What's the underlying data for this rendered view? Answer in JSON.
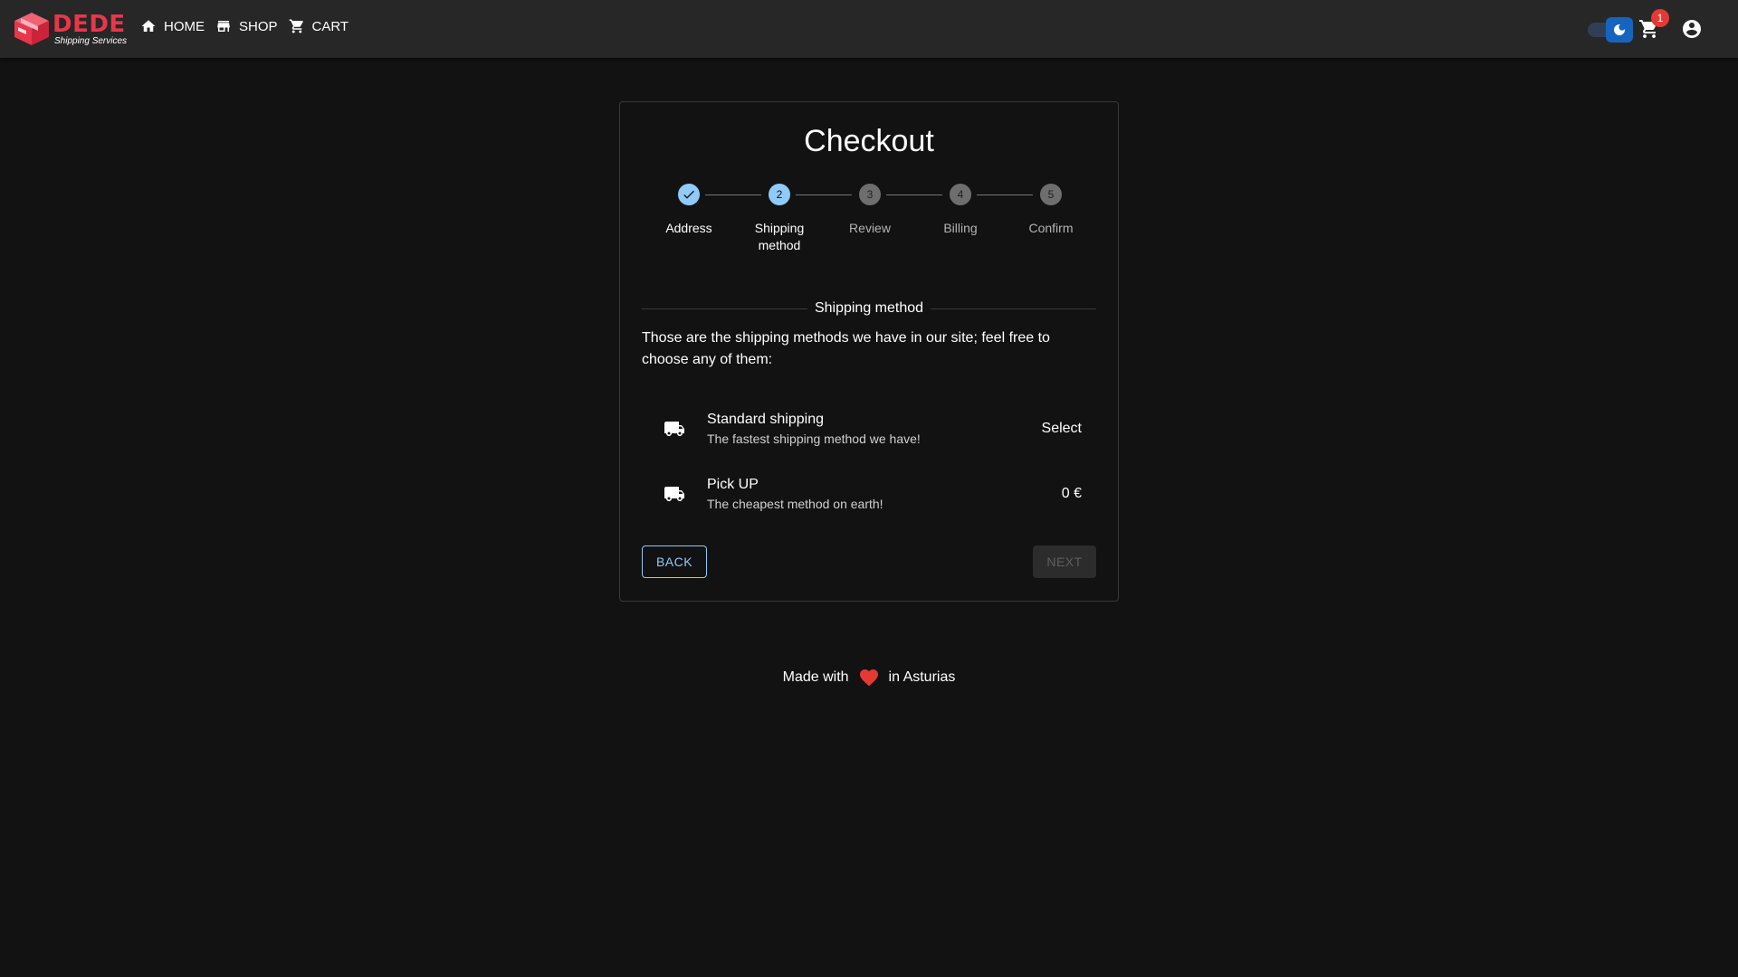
{
  "brand": {
    "name": "DEDE",
    "subtitle": "Shipping Services",
    "color": "#e8364a"
  },
  "nav": {
    "items": [
      {
        "label": "HOME",
        "icon": "home-icon"
      },
      {
        "label": "SHOP",
        "icon": "store-icon"
      },
      {
        "label": "CART",
        "icon": "cart-icon"
      }
    ]
  },
  "toolbar": {
    "theme_toggle_icon": "moon-icon",
    "cart_badge": "1",
    "account_icon": "account-circle-icon"
  },
  "checkout": {
    "title": "Checkout",
    "steps": [
      {
        "number": "1",
        "label": "Address",
        "state": "done"
      },
      {
        "number": "2",
        "label": "Shipping method",
        "state": "active"
      },
      {
        "number": "3",
        "label": "Review",
        "state": "pending"
      },
      {
        "number": "4",
        "label": "Billing",
        "state": "pending"
      },
      {
        "number": "5",
        "label": "Confirm",
        "state": "pending"
      }
    ],
    "section_title": "Shipping method",
    "intro": "Those are the shipping methods we have in our site; feel free to choose any of them:",
    "methods": [
      {
        "name": "Standard shipping",
        "description": "The fastest shipping method we have!",
        "price": "Select",
        "icon": "truck-icon"
      },
      {
        "name": "Pick UP",
        "description": "The cheapest method on earth!",
        "price": "0 €",
        "icon": "truck-icon"
      }
    ],
    "back_label": "BACK",
    "next_label": "NEXT"
  },
  "footer": {
    "before": "Made with",
    "after": "in Asturias",
    "icon": "heart-icon"
  },
  "colors": {
    "background": "#121212",
    "appbar": "#272727",
    "accent": "#90caf9",
    "badge": "#e53935"
  }
}
